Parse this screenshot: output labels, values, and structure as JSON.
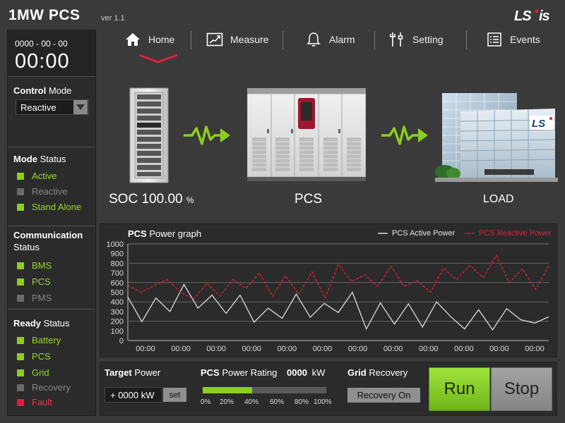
{
  "header": {
    "title": "1MW  PCS",
    "version": "ver 1.1",
    "brand": "LS is"
  },
  "nav": {
    "items": [
      {
        "label": "Home",
        "icon": "home-icon",
        "active": true
      },
      {
        "label": "Measure",
        "icon": "measure-icon"
      },
      {
        "label": "Alarm",
        "icon": "bell-icon"
      },
      {
        "label": "Setting",
        "icon": "tools-icon"
      },
      {
        "label": "Events",
        "icon": "list-icon"
      }
    ]
  },
  "clock": {
    "date": "0000 - 00 - 00",
    "time": "00:00"
  },
  "control_mode": {
    "title_bold": "Control",
    "title_rest": " Mode",
    "selected": "Reactive"
  },
  "mode_status": {
    "title_bold": "Mode",
    "title_rest": " Status",
    "items": [
      {
        "label": "Active",
        "state": "on"
      },
      {
        "label": "Reactive",
        "state": "off"
      },
      {
        "label": "Stand Alone",
        "state": "on"
      }
    ]
  },
  "communication_status": {
    "title_bold": "Communication",
    "title_rest": "Status",
    "items": [
      {
        "label": "BMS",
        "state": "on"
      },
      {
        "label": "PCS",
        "state": "on"
      },
      {
        "label": "PMS",
        "state": "off"
      }
    ]
  },
  "ready_status": {
    "title_bold": "Ready",
    "title_rest": " Status",
    "items": [
      {
        "label": "Battery",
        "state": "on"
      },
      {
        "label": "PCS",
        "state": "on"
      },
      {
        "label": "Grid",
        "state": "on"
      },
      {
        "label": "Recovery",
        "state": "off"
      },
      {
        "label": "Fault",
        "state": "fault"
      }
    ]
  },
  "diagram": {
    "soc_prefix": "SOC",
    "soc_value": "100.00",
    "soc_unit": "%",
    "pcs_label": "PCS",
    "load_label": "LOAD",
    "load_sign": "LS"
  },
  "graph": {
    "title_bold": "PCS",
    "title_rest": " Power graph",
    "legend_active": "PCS Active Power",
    "legend_reactive": "PCS Reactive Power",
    "colors": {
      "active": "#dddddd",
      "reactive": "#e0203a"
    }
  },
  "chart_data": {
    "type": "line",
    "title": "PCS Power graph",
    "ylim": [
      0,
      1000
    ],
    "yticks": [
      0,
      100,
      200,
      300,
      400,
      500,
      600,
      700,
      800,
      900,
      1000
    ],
    "xticks": [
      "00:00",
      "00:00",
      "00:00",
      "00:00",
      "00:00",
      "00:00",
      "00:00",
      "00:00",
      "00:00",
      "00:00",
      "00:00",
      "00:00"
    ],
    "grid": true,
    "legend_placement": "top-right",
    "series": [
      {
        "name": "PCS Active Power",
        "values": [
          450,
          195,
          440,
          300,
          580,
          335,
          470,
          280,
          470,
          190,
          335,
          230,
          480,
          240,
          385,
          290,
          500,
          120,
          390,
          170,
          380,
          140,
          400,
          250,
          120,
          320,
          110,
          330,
          215,
          180,
          245
        ]
      },
      {
        "name": "PCS Reactive Power",
        "values": [
          570,
          500,
          570,
          630,
          500,
          430,
          590,
          460,
          630,
          540,
          700,
          460,
          670,
          480,
          710,
          440,
          790,
          610,
          680,
          560,
          770,
          560,
          620,
          500,
          750,
          630,
          780,
          650,
          880,
          600,
          740,
          530,
          770
        ]
      }
    ]
  },
  "target_power": {
    "title_bold": "Target",
    "title_rest": " Power",
    "value": "+ 0000 kW",
    "set_label": "set"
  },
  "power_rating": {
    "title_bold": "PCS",
    "title_rest": " Power Rating",
    "value": "0000",
    "unit": "kW",
    "fill_fraction": 0.4,
    "ticks": [
      "0%",
      "20%",
      "40%",
      "60%",
      "80%",
      "100%"
    ]
  },
  "grid_recovery": {
    "title_bold": "Grid",
    "title_rest": " Recovery",
    "button": "Recovery On"
  },
  "controls": {
    "run": "Run",
    "stop": "Stop"
  }
}
